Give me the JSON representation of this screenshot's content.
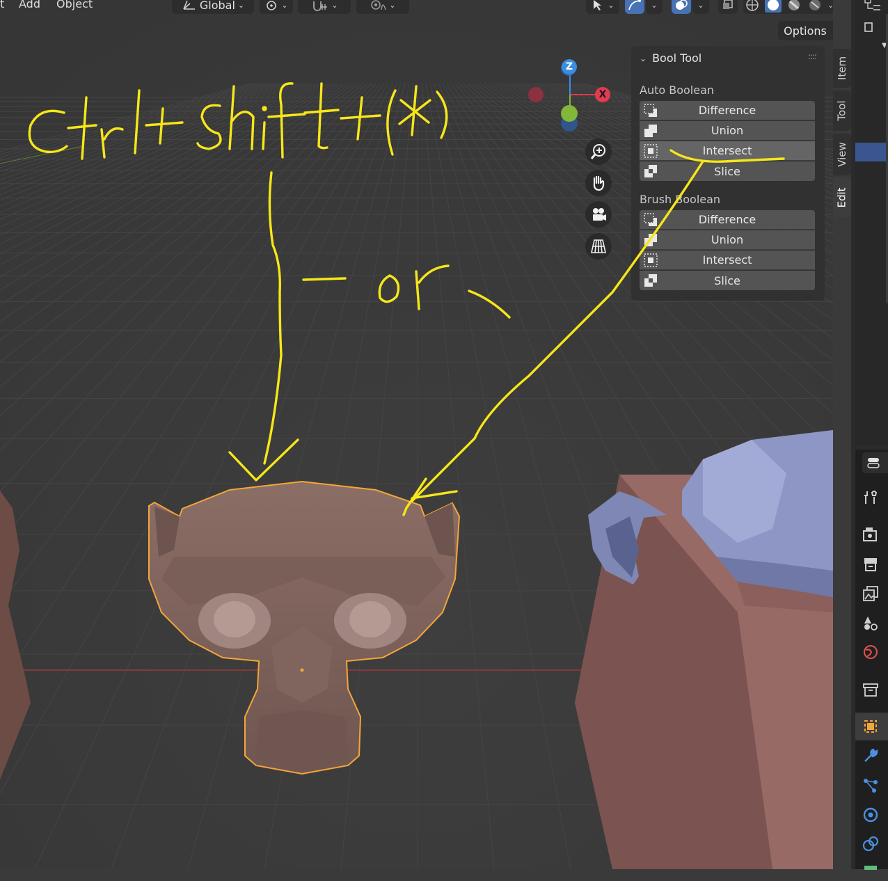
{
  "header": {
    "menu_partial": "t",
    "menu_add": "Add",
    "menu_object": "Object",
    "transform_orientation": "Global",
    "options_label": "Options"
  },
  "bool_tool": {
    "title": "Bool Tool",
    "auto_boolean": {
      "label": "Auto Boolean",
      "items": [
        "Difference",
        "Union",
        "Intersect",
        "Slice"
      ]
    },
    "brush_boolean": {
      "label": "Brush Boolean",
      "items": [
        "Difference",
        "Union",
        "Intersect",
        "Slice"
      ]
    }
  },
  "sidebar_tabs": [
    "Item",
    "Tool",
    "View",
    "Edit"
  ],
  "gizmo": {
    "z": "Z",
    "x": "X"
  },
  "annotation": {
    "text_shortcut": "ctrl+shift+(*)",
    "text_or": "- or -"
  },
  "colors": {
    "viewport_bg": "#3a3a3a",
    "selection_outline": "#f5a53a",
    "annotation": "#f7e61a",
    "axis_x": "#e23a4f",
    "axis_y": "#82b737",
    "axis_z": "#3b8de0",
    "active_tab_blue": "#4772b3"
  }
}
